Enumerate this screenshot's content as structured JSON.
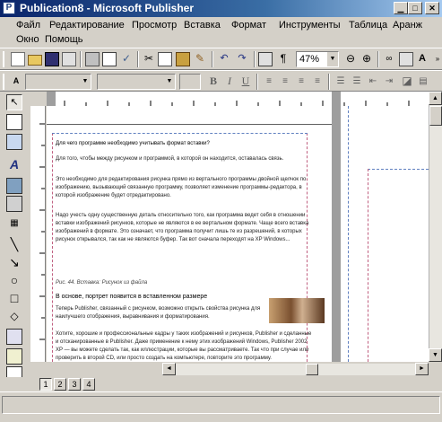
{
  "window": {
    "title": "Publication8 - Microsoft Publisher",
    "app_icon": "publisher-icon",
    "controls": [
      "minimize-icon",
      "maximize-icon",
      "close-icon"
    ]
  },
  "menu": {
    "items": [
      "Файл",
      "Редактирование",
      "Просмотр",
      "Вставка",
      "Формат",
      "Инструменты",
      "Таблица",
      "Аранж",
      "Окно",
      "Помощь"
    ]
  },
  "toolbar": {
    "zoom": "47%"
  },
  "formatting": {
    "style": "",
    "font": "",
    "size": "",
    "bold": "B",
    "italic": "I",
    "underline": "U"
  },
  "document": {
    "p1": "Для чего программе необходимо учитывать формат вставки?",
    "p2": "Для того, чтобы между рисунком и программой, в которой он находится, оставалась связь.",
    "p3": "Это необходимо для редактирования рисунка прямо из вертального программы двойной щелчок по изображению, вызывающий связанную программу, позволяет изменение программы-редактора, в которой изображение будет отредактировано.",
    "p4": "Надо учесть одну существенную деталь относительно того, как программа ведет себя в отношении вставки изображений рисунков, которые не являются в ее вертальном формате. Чаще всего вставка изображений в формате. Это означает, что программа получит лишь те из разрешений, в которых рисунок открывался, так как не являются буфер. Так вот сначала переходят на XP Windows...",
    "caption": "Рис. 44. Вставка: Рисунок из файла",
    "p5": "В основе, портрет появится в вставленном размере",
    "p6": "Теперь Publisher, связанный с рисунком, возможно открыть свойства рисунка для наилучшего отображения, выравнивания и форматирования.",
    "p7": "Хотите, хорошие и профессиональные кадры у таких изображений и рисунков, Publisher и сделанные и отсканированные в Publisher. Даже применение к нему этих изображений Windows, Publisher 2002 XP — вы можете сделать так, как иллюстрации, которые вы рассматриваете. Так что при случае или проверить в второй CD, или просто создать на компьютере, повторите это программу."
  },
  "pages": [
    "1",
    "2",
    "3",
    "4"
  ]
}
